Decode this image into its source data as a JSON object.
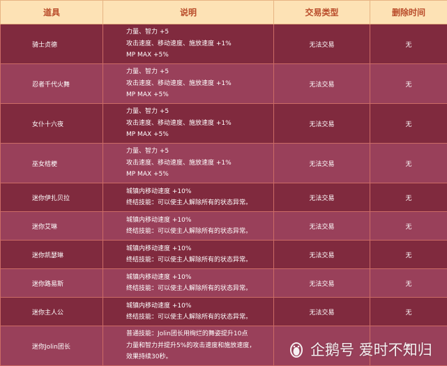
{
  "header": {
    "col_item": "道具",
    "col_desc": "说明",
    "col_trade": "交易类型",
    "col_delete": "删除时间"
  },
  "rows": [
    {
      "item": "骑士贞德",
      "desc": [
        "力量、智力 +5",
        "攻击速度、移动速度、施放速度 +1%",
        "MP MAX +5%"
      ],
      "trade": "无法交易",
      "delete": "无"
    },
    {
      "item": "忍者千代火舞",
      "desc": [
        "力量、智力 +5",
        "攻击速度、移动速度、施放速度 +1%",
        "MP MAX +5%"
      ],
      "trade": "无法交易",
      "delete": "无"
    },
    {
      "item": "女仆十六夜",
      "desc": [
        "力量、智力 +5",
        "攻击速度、移动速度、施放速度 +1%",
        "MP MAX +5%"
      ],
      "trade": "无法交易",
      "delete": "无"
    },
    {
      "item": "巫女桔梗",
      "desc": [
        "力量、智力 +5",
        "攻击速度、移动速度、施放速度 +1%",
        "MP MAX +5%"
      ],
      "trade": "无法交易",
      "delete": "无"
    },
    {
      "item": "迷你伊扎贝拉",
      "desc": [
        "城镇内移动速度 +10%",
        "终结技能：可以使主人解除所有的状态异常。"
      ],
      "trade": "无法交易",
      "delete": "无"
    },
    {
      "item": "迷你艾琳",
      "desc": [
        "城镇内移动速度 +10%",
        "终结技能：可以使主人解除所有的状态异常。"
      ],
      "trade": "无法交易",
      "delete": "无"
    },
    {
      "item": "迷你凯瑟琳",
      "desc": [
        "城镇内移动速度 +10%",
        "终结技能：可以使主人解除所有的状态异常。"
      ],
      "trade": "无法交易",
      "delete": "无"
    },
    {
      "item": "迷你路易斯",
      "desc": [
        "城镇内移动速度 +10%",
        "终结技能：可以使主人解除所有的状态异常。"
      ],
      "trade": "无法交易",
      "delete": "无"
    },
    {
      "item": "迷你主人公",
      "desc": [
        "城镇内移动速度 +10%",
        "终结技能：可以使主人解除所有的状态异常。"
      ],
      "trade": "无法交易",
      "delete": "无"
    },
    {
      "item": "迷你Jolin团长",
      "desc": [
        "普通技能：Jolin团长用绚烂的舞姿提升10点",
        "力量和智力并提升5%的攻击速度和施放速度，",
        "效果持续30秒。"
      ],
      "trade": "",
      "delete": "无"
    }
  ],
  "watermark": {
    "icon": "penguin-icon",
    "text": "企鹅号 爱时不知归"
  }
}
